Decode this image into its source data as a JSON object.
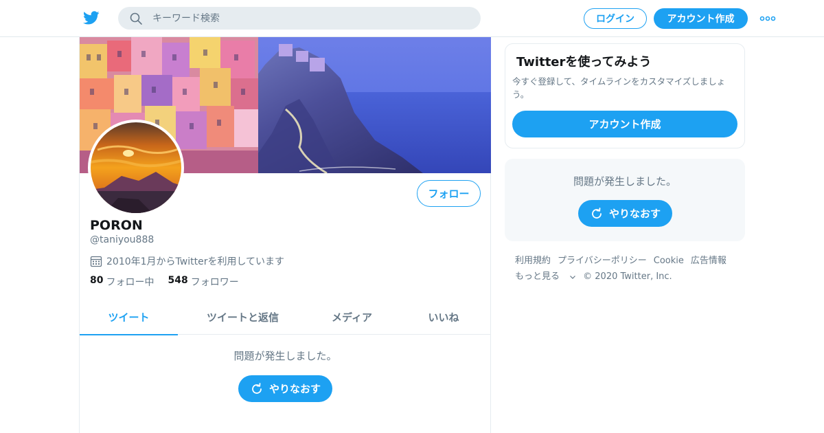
{
  "header": {
    "search_placeholder": "キーワード検索",
    "login_label": "ログイン",
    "signup_label": "アカウント作成"
  },
  "profile": {
    "follow_label": "フォロー",
    "name": "PORON",
    "handle": "@taniyou888",
    "joined": "2010年1月からTwitterを利用しています",
    "following_count": "80",
    "following_label": "フォロー中",
    "followers_count": "548",
    "followers_label": "フォロワー"
  },
  "tabs": [
    {
      "label": "ツイート",
      "active": true
    },
    {
      "label": "ツイートと返信",
      "active": false
    },
    {
      "label": "メディア",
      "active": false
    },
    {
      "label": "いいね",
      "active": false
    }
  ],
  "timeline": {
    "error_message": "問題が発生しました。",
    "retry_label": "やりなおす"
  },
  "sidebar": {
    "signup_card": {
      "title": "Twitterを使ってみよう",
      "description": "今すぐ登録して、タイムラインをカスタマイズしましょう。",
      "button_label": "アカウント作成"
    },
    "error_card": {
      "message": "問題が発生しました。",
      "retry_label": "やりなおす"
    },
    "footer": {
      "links": [
        "利用規約",
        "プライバシーポリシー",
        "Cookie",
        "広告情報"
      ],
      "more_label": "もっと見る",
      "copyright": "© 2020 Twitter, Inc."
    }
  },
  "colors": {
    "brand": "#1da1f2",
    "secondary_text": "#657786",
    "border": "#e6ecf0"
  }
}
